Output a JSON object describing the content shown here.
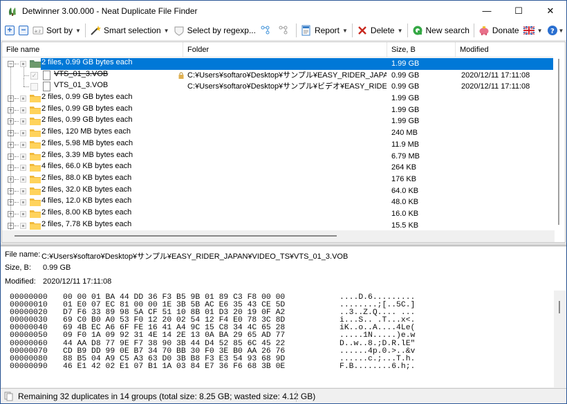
{
  "window": {
    "title": "Detwinner 3.00.000 - Neat Duplicate File Finder",
    "controls": {
      "minimize": "—",
      "maximize": "☐",
      "close": "✕"
    }
  },
  "toolbar": {
    "expand_all": "+",
    "collapse_all": "−",
    "sort_by": "Sort by",
    "smart_selection": "Smart selection",
    "select_by_regexp": "Select by regexp...",
    "report": "Report",
    "delete": "Delete",
    "new_search": "New search",
    "donate": "Donate"
  },
  "list": {
    "columns": [
      "File name",
      "Folder",
      "Size, B",
      "Modified"
    ],
    "groups": [
      {
        "label": "2 files, 0.99 GB bytes each",
        "size": "1.99 GB",
        "expanded": true,
        "selected": true,
        "files": [
          {
            "name": "VTS_01_3.VOB",
            "folder": "C:¥Users¥softaro¥Desktop¥サンプル¥EASY_RIDER_JAPA...",
            "size": "0.99 GB",
            "modified": "2020/12/11 17:11:08",
            "checked": true,
            "locked": true
          },
          {
            "name": "VTS_01_3.VOB",
            "folder": "C:¥Users¥softaro¥Desktop¥サンプル¥ビデオ¥EASY_RIDER...",
            "size": "0.99 GB",
            "modified": "2020/12/11 17:11:08",
            "checked": false,
            "locked": false
          }
        ]
      },
      {
        "label": "2 files, 0.99 GB bytes each",
        "size": "1.99 GB"
      },
      {
        "label": "2 files, 0.99 GB bytes each",
        "size": "1.99 GB"
      },
      {
        "label": "2 files, 0.99 GB bytes each",
        "size": "1.99 GB"
      },
      {
        "label": "2 files, 120 MB bytes each",
        "size": "240 MB"
      },
      {
        "label": "2 files, 5.98 MB bytes each",
        "size": "11.9 MB"
      },
      {
        "label": "2 files, 3.39 MB bytes each",
        "size": "6.79 MB"
      },
      {
        "label": "4 files, 66.0 KB bytes each",
        "size": "264 KB"
      },
      {
        "label": "2 files, 88.0 KB bytes each",
        "size": "176 KB"
      },
      {
        "label": "2 files, 32.0 KB bytes each",
        "size": "64.0 KB"
      },
      {
        "label": "4 files, 12.0 KB bytes each",
        "size": "48.0 KB"
      },
      {
        "label": "2 files, 8.00 KB bytes each",
        "size": "16.0 KB"
      },
      {
        "label": "2 files, 7.78 KB bytes each",
        "size": "15.5 KB"
      }
    ]
  },
  "details": {
    "file_name_label": "File name:",
    "file_name": "C:¥Users¥softaro¥Desktop¥サンプル¥EASY_RIDER_JAPAN¥VIDEO_TS¥VTS_01_3.VOB",
    "size_label": "Size, B:",
    "size": "0.99 GB",
    "modified_label": "Modified:",
    "modified": "2020/12/11 17:11:08",
    "hex": [
      {
        "offset": "00000000",
        "bytes": "00 00 01 BA 44 DD 36 F3 B5 9B 01 89 C3 F8 00 00",
        "ascii": "....D.6........."
      },
      {
        "offset": "00000010",
        "bytes": "01 E0 07 EC 81 00 00 1E 3B 5B AC E6 35 43 CE 5D",
        "ascii": "........;[..5C.]"
      },
      {
        "offset": "00000020",
        "bytes": "D7 F6 33 89 98 5A CF 51 10 8B 01 D3 20 19 0F A2",
        "ascii": "..3..Z.Q.... ..."
      },
      {
        "offset": "00000030",
        "bytes": "69 C0 B0 A0 53 F0 12 20 02 54 12 F4 E0 78 3C 8D",
        "ascii": "i...S.. .T...x<."
      },
      {
        "offset": "00000040",
        "bytes": "69 4B EC A6 6F FE 16 41 A4 9C 15 C8 34 4C 65 28",
        "ascii": "iK..o..A....4Le("
      },
      {
        "offset": "00000050",
        "bytes": "09 F0 1A 09 92 31 4E 14 2E 13 0A BA 29 65 AD 77",
        "ascii": ".....1N.....)e.w"
      },
      {
        "offset": "00000060",
        "bytes": "44 AA D8 77 9E F7 38 90 3B 44 D4 52 85 6C 45 22",
        "ascii": "D..w..8.;D.R.lE\""
      },
      {
        "offset": "00000070",
        "bytes": "CD B9 DD 99 0E B7 34 70 BB 30 F0 3E B0 AA 26 76",
        "ascii": "......4p.0.>..&v"
      },
      {
        "offset": "00000080",
        "bytes": "88 B5 04 A9 C5 A3 63 D0 3B B8 F3 E3 54 93 68 9D",
        "ascii": "......c.;...T.h."
      },
      {
        "offset": "00000090",
        "bytes": "46 E1 42 02 E1 07 B1 1A 03 84 E7 36 F6 68 3B 0E",
        "ascii": "F.B........6.h;."
      }
    ]
  },
  "status": {
    "text": "Remaining 32 duplicates in 14 groups (total size: 8.25 GB; wasted size: 4.12 GB)"
  },
  "colors": {
    "selection": "#0078d7",
    "folder": "#f8c94a",
    "accent": "#2a6fc9"
  }
}
